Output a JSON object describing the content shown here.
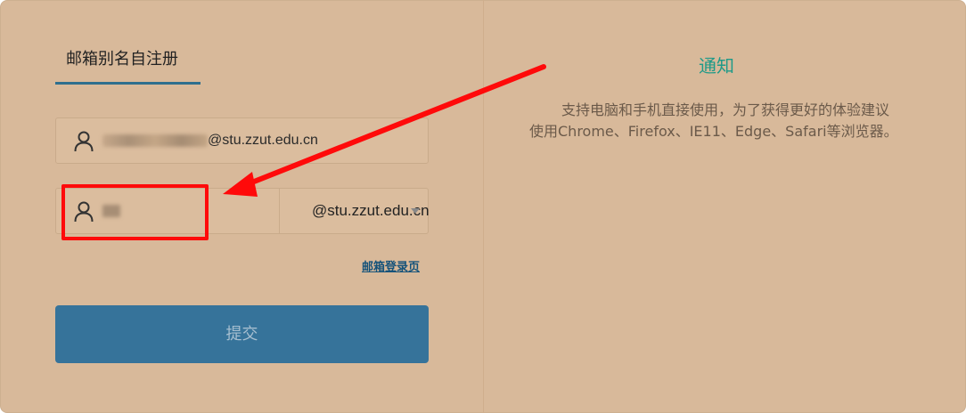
{
  "tab": {
    "title": "邮箱别名自注册"
  },
  "fields": {
    "email_suffix_text": "@stu.zzut.edu.cn",
    "domain_selected": "@stu.zzut.edu.cn"
  },
  "links": {
    "login_page": "邮箱登录页"
  },
  "form": {
    "submit_label": "提交"
  },
  "notice": {
    "title": "通知",
    "line1": "支持电脑和手机直接使用，为了获得更好的体验建议",
    "line2": "使用Chrome、Firefox、IE11、Edge、Safari等浏览器。"
  },
  "colors": {
    "background": "#d8b99a",
    "accent_blue": "#36739a",
    "notice_title": "#1f9a88",
    "annotation_red": "#ff0a0a"
  },
  "icons": {
    "field_icon": "user-icon",
    "dropdown_icon": "caret-down-icon"
  }
}
